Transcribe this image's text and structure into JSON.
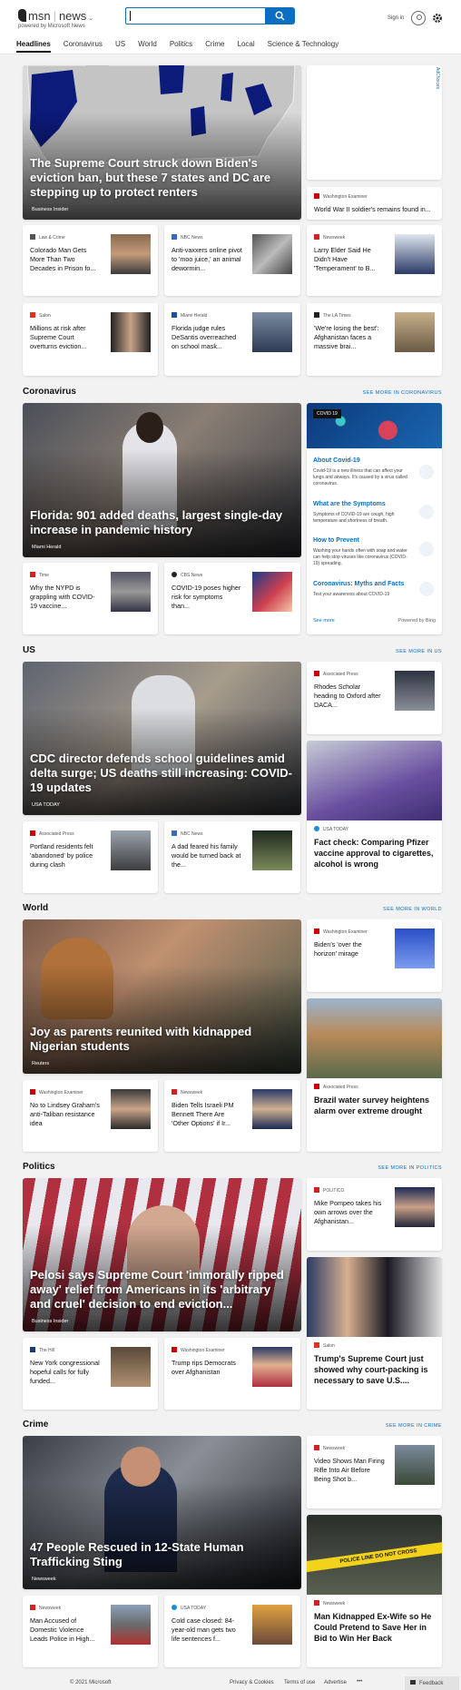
{
  "header": {
    "logo_msn": "msn",
    "logo_news": "news",
    "powered_by": "powered by Microsoft News",
    "search_placeholder": "",
    "sign_in": "Sign in"
  },
  "nav": {
    "items": [
      "Headlines",
      "Coronavirus",
      "US",
      "World",
      "Politics",
      "Crime",
      "Local",
      "Science & Technology"
    ]
  },
  "adchoices": "AdChoices",
  "headlines": {
    "hero": {
      "title": "The Supreme Court struck down Biden's eviction ban, but these 7 states and DC are stepping up to protect renters",
      "source": "Business Insider"
    },
    "side": {
      "source": "Washington Examiner",
      "headline": "World War II soldier's remains found in..."
    },
    "cards": [
      {
        "source": "Law & Crime",
        "headline": "Colorado Man Gets More Than Two Decades in Prison fo..."
      },
      {
        "source": "NBC News",
        "headline": "Anti-vaxxers online pivot to 'moo juice,' an animal dewormin..."
      },
      {
        "source": "Newsweek",
        "headline": "Larry Elder Said He Didn't Have 'Temperament' to B..."
      },
      {
        "source": "Salon",
        "headline": "Millions at risk after Supreme Court overturns eviction..."
      },
      {
        "source": "Miami Herald",
        "headline": "Florida judge rules DeSantis overreached on school mask..."
      },
      {
        "source": "The LA Times",
        "headline": "'We're losing the best': Afghanistan faces a massive brai..."
      }
    ]
  },
  "coronavirus": {
    "title": "Coronavirus",
    "see_more": "SEE MORE IN CORONAVIRUS",
    "hero": {
      "title": "Florida: 901 added deaths, largest single-day increase in pandemic history",
      "source": "Miami Herald"
    },
    "cards": [
      {
        "source": "Time",
        "headline": "Why the NYPD is grappling with COVID-19 vaccine..."
      },
      {
        "source": "CBS News",
        "headline": "COVID-19 poses higher risk for symptoms than..."
      }
    ],
    "info": {
      "badge": "COVID 19",
      "items": [
        {
          "title": "About Covid-19",
          "text": "Covid-19 is a new illness that can affect your lungs and airways. It's caused by a virus called coronavirus."
        },
        {
          "title": "What are the Symptoms",
          "text": "Symptoms of COVID-19 are cough, high temperature and shortness of breath."
        },
        {
          "title": "How to Prevent",
          "text": "Washing your hands often with soap and water can help stop viruses like coronavirus (COVID-19) spreading."
        },
        {
          "title": "Coronavirus: Myths and Facts",
          "text": "Test your awareness about COVID-19"
        }
      ],
      "see_more": "See more",
      "powered": "Powered by Bing"
    }
  },
  "us": {
    "title": "US",
    "see_more": "SEE MORE IN US",
    "hero": {
      "title": "CDC director defends school guidelines amid delta surge; US deaths still increasing: COVID-19 updates",
      "source": "USA TODAY"
    },
    "side": {
      "source": "Associated Press",
      "headline": "Rhodes Scholar heading to Oxford after DACA..."
    },
    "tall": {
      "source": "USA TODAY",
      "headline": "Fact check: Comparing Pfizer vaccine approval to cigarettes, alcohol is wrong"
    },
    "cards": [
      {
        "source": "Associated Press",
        "headline": "Portland residents felt 'abandoned' by police during clash"
      },
      {
        "source": "NBC News",
        "headline": "A dad feared his family would be turned back at the..."
      }
    ]
  },
  "world": {
    "title": "World",
    "see_more": "SEE MORE IN WORLD",
    "hero": {
      "title": "Joy as parents reunited with kidnapped Nigerian students",
      "source": "Reuters"
    },
    "side": {
      "source": "Washington Examiner",
      "headline": "Biden's 'over the horizon' mirage"
    },
    "tall": {
      "source": "Associated Press",
      "headline": "Brazil water survey heightens alarm over extreme drought"
    },
    "cards": [
      {
        "source": "Washington Examiner",
        "headline": "No to Lindsey Graham's anti-Taliban resistance idea"
      },
      {
        "source": "Newsweek",
        "headline": "Biden Tells Israeli PM Bennett There Are 'Other Options' if Ir..."
      }
    ]
  },
  "politics": {
    "title": "Politics",
    "see_more": "SEE MORE IN POLITICS",
    "hero": {
      "title": "Pelosi says Supreme Court 'immorally ripped away' relief from Americans in its 'arbitrary and cruel' decision to end eviction...",
      "source": "Business Insider"
    },
    "side": {
      "source": "POLITICO",
      "headline": "Mike Pompeo takes his own arrows over the Afghanistan..."
    },
    "tall": {
      "source": "Salon",
      "headline": "Trump's Supreme Court just showed why court-packing is necessary to save U.S...."
    },
    "cards": [
      {
        "source": "The Hill",
        "headline": "New York congressional hopeful calls for fully funded..."
      },
      {
        "source": "Washington Examiner",
        "headline": "Trump rips Democrats over Afghanistan"
      }
    ]
  },
  "crime": {
    "title": "Crime",
    "see_more": "SEE MORE IN CRIME",
    "hero": {
      "title": "47 People Rescued in 12-State Human Trafficking Sting",
      "source": "Newsweek"
    },
    "side": {
      "source": "Newsweek",
      "headline": "Video Shows Man Firing Rifle Into Air Before Being Shot b..."
    },
    "tall": {
      "source": "Newsweek",
      "headline": "Man Kidnapped Ex-Wife so He Could Pretend to Save Her in Bid to Win Her Back"
    },
    "tall_image_text": "POLICE LINE DO NOT CROSS",
    "cards": [
      {
        "source": "Newsweek",
        "headline": "Man Accused of Domestic Violence Leads Police in High..."
      },
      {
        "source": "USA TODAY",
        "headline": "Cold case closed: 84-year-old man gets two life sentences f..."
      }
    ]
  },
  "footer": {
    "copyright": "© 2021 Microsoft",
    "privacy": "Privacy & Cookies",
    "terms": "Terms of use",
    "advertise": "Advertise",
    "more": "•••",
    "feedback": "Feedback"
  },
  "colors": {
    "accent": "#0a6fc2",
    "background": "#f2f2f2"
  }
}
